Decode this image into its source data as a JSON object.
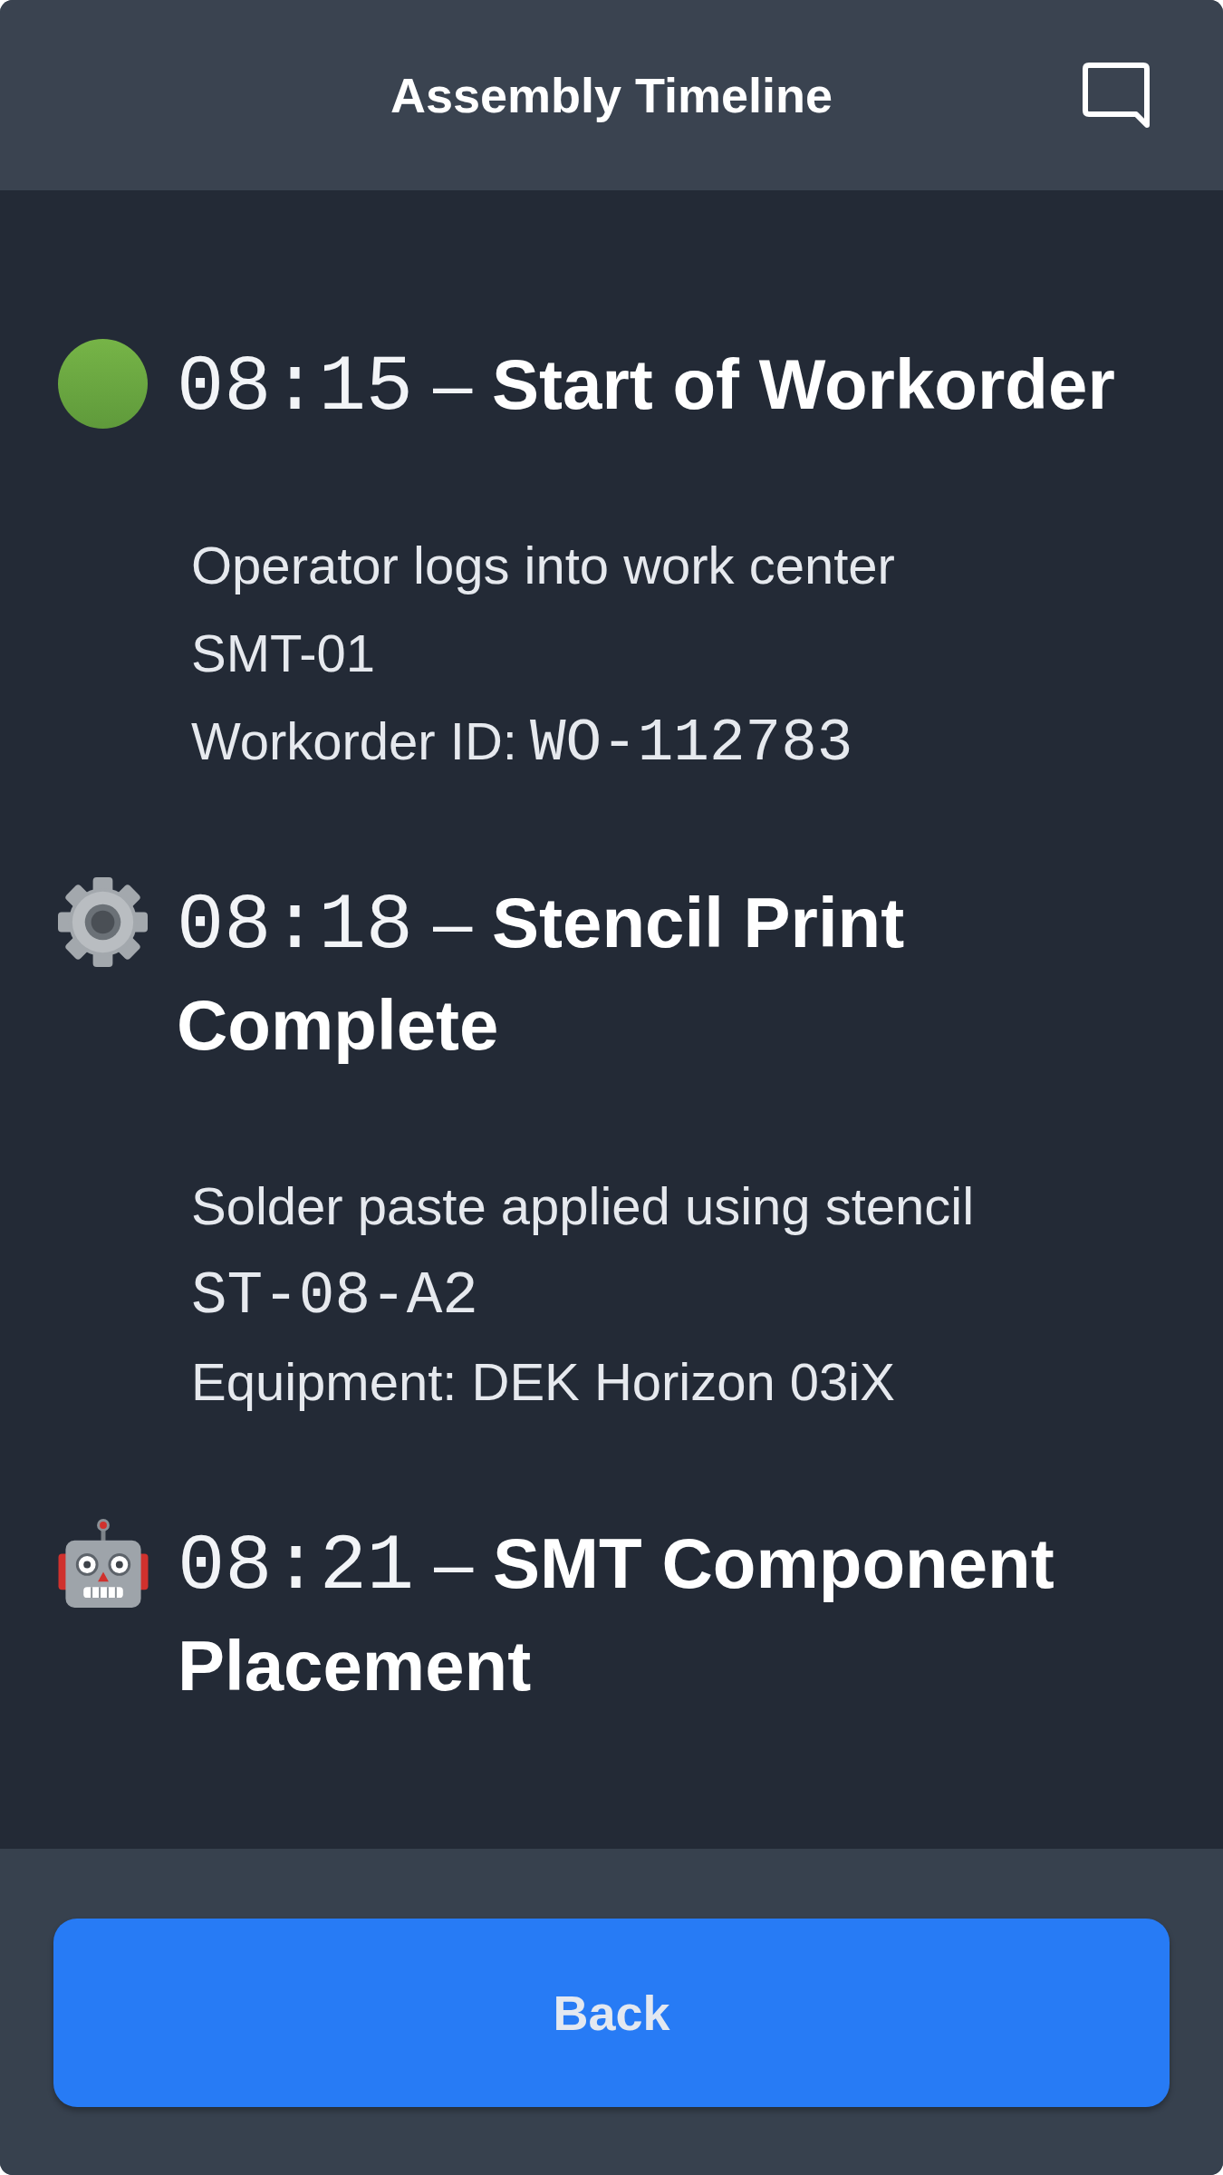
{
  "header": {
    "title": "Assembly Timeline"
  },
  "events": [
    {
      "kind": "dot",
      "time": "08:15",
      "separator": "–",
      "title": "Start of Workorder",
      "details": [
        {
          "text": "Operator logs into work center"
        },
        {
          "text": "SMT-01"
        },
        {
          "text": "Workorder ID:",
          "code": "WO-112783"
        }
      ]
    },
    {
      "kind": "gear",
      "time": "08:18",
      "separator": "–",
      "title": "Stencil Print Complete",
      "details": [
        {
          "text": "Solder paste applied using stencil"
        },
        {
          "code": "ST-08-A2"
        },
        {
          "text": "Equipment: DEK Horizon 03iX"
        }
      ]
    },
    {
      "kind": "robot",
      "time": "08:21",
      "separator": "–",
      "title": "SMT Component Placement"
    }
  ],
  "footer": {
    "button": "Back"
  }
}
